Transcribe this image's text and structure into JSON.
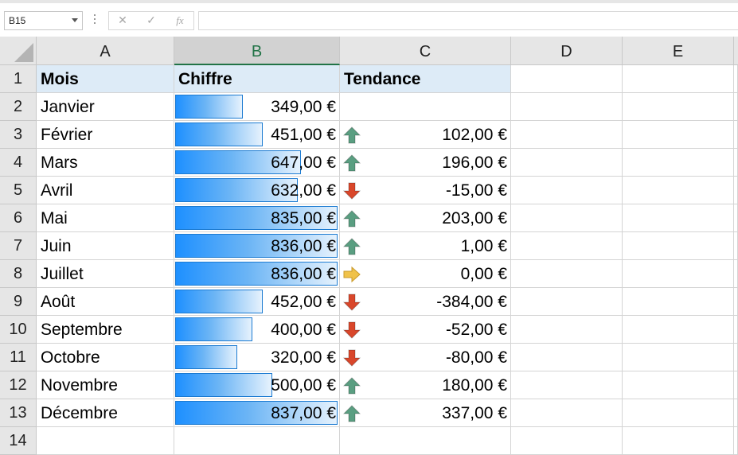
{
  "formula_bar": {
    "name_box": "B15",
    "cancel_icon": "✕",
    "enter_icon": "✓",
    "fx_label": "fx",
    "formula": ""
  },
  "columns": [
    "A",
    "B",
    "C",
    "D",
    "E"
  ],
  "selected_column": "B",
  "row_numbers": [
    "1",
    "2",
    "3",
    "4",
    "5",
    "6",
    "7",
    "8",
    "9",
    "10",
    "11",
    "12",
    "13",
    "14"
  ],
  "header": {
    "mois": "Mois",
    "chiffre": "Chiffre",
    "tendance": "Tendance"
  },
  "bar_max": 837,
  "rows": [
    {
      "mois": "Janvier",
      "chiffre": "349,00 €",
      "value": 349,
      "tendance": "",
      "trend": "none"
    },
    {
      "mois": "Février",
      "chiffre": "451,00 €",
      "value": 451,
      "tendance": "102,00 €",
      "trend": "up"
    },
    {
      "mois": "Mars",
      "chiffre": "647,00 €",
      "value": 647,
      "tendance": "196,00 €",
      "trend": "up"
    },
    {
      "mois": "Avril",
      "chiffre": "632,00 €",
      "value": 632,
      "tendance": "-15,00 €",
      "trend": "down"
    },
    {
      "mois": "Mai",
      "chiffre": "835,00 €",
      "value": 835,
      "tendance": "203,00 €",
      "trend": "up"
    },
    {
      "mois": "Juin",
      "chiffre": "836,00 €",
      "value": 836,
      "tendance": "1,00 €",
      "trend": "up"
    },
    {
      "mois": "Juillet",
      "chiffre": "836,00 €",
      "value": 836,
      "tendance": "0,00 €",
      "trend": "flat"
    },
    {
      "mois": "Août",
      "chiffre": "452,00 €",
      "value": 452,
      "tendance": "-384,00 €",
      "trend": "down"
    },
    {
      "mois": "Septembre",
      "chiffre": "400,00 €",
      "value": 400,
      "tendance": "-52,00 €",
      "trend": "down"
    },
    {
      "mois": "Octobre",
      "chiffre": "320,00 €",
      "value": 320,
      "tendance": "-80,00 €",
      "trend": "down"
    },
    {
      "mois": "Novembre",
      "chiffre": "500,00 €",
      "value": 500,
      "tendance": "180,00 €",
      "trend": "up"
    },
    {
      "mois": "Décembre",
      "chiffre": "837,00 €",
      "value": 837,
      "tendance": "337,00 €",
      "trend": "up"
    }
  ],
  "icons": {
    "up": "arrow-up-green-icon",
    "down": "arrow-down-red-icon",
    "flat": "arrow-right-yellow-icon"
  },
  "colors": {
    "up": "#5a9e81",
    "down": "#d9472b",
    "flat": "#f0c24a",
    "bar": "#1e90ff",
    "header_fill": "#ddebf7",
    "accent": "#217346"
  }
}
